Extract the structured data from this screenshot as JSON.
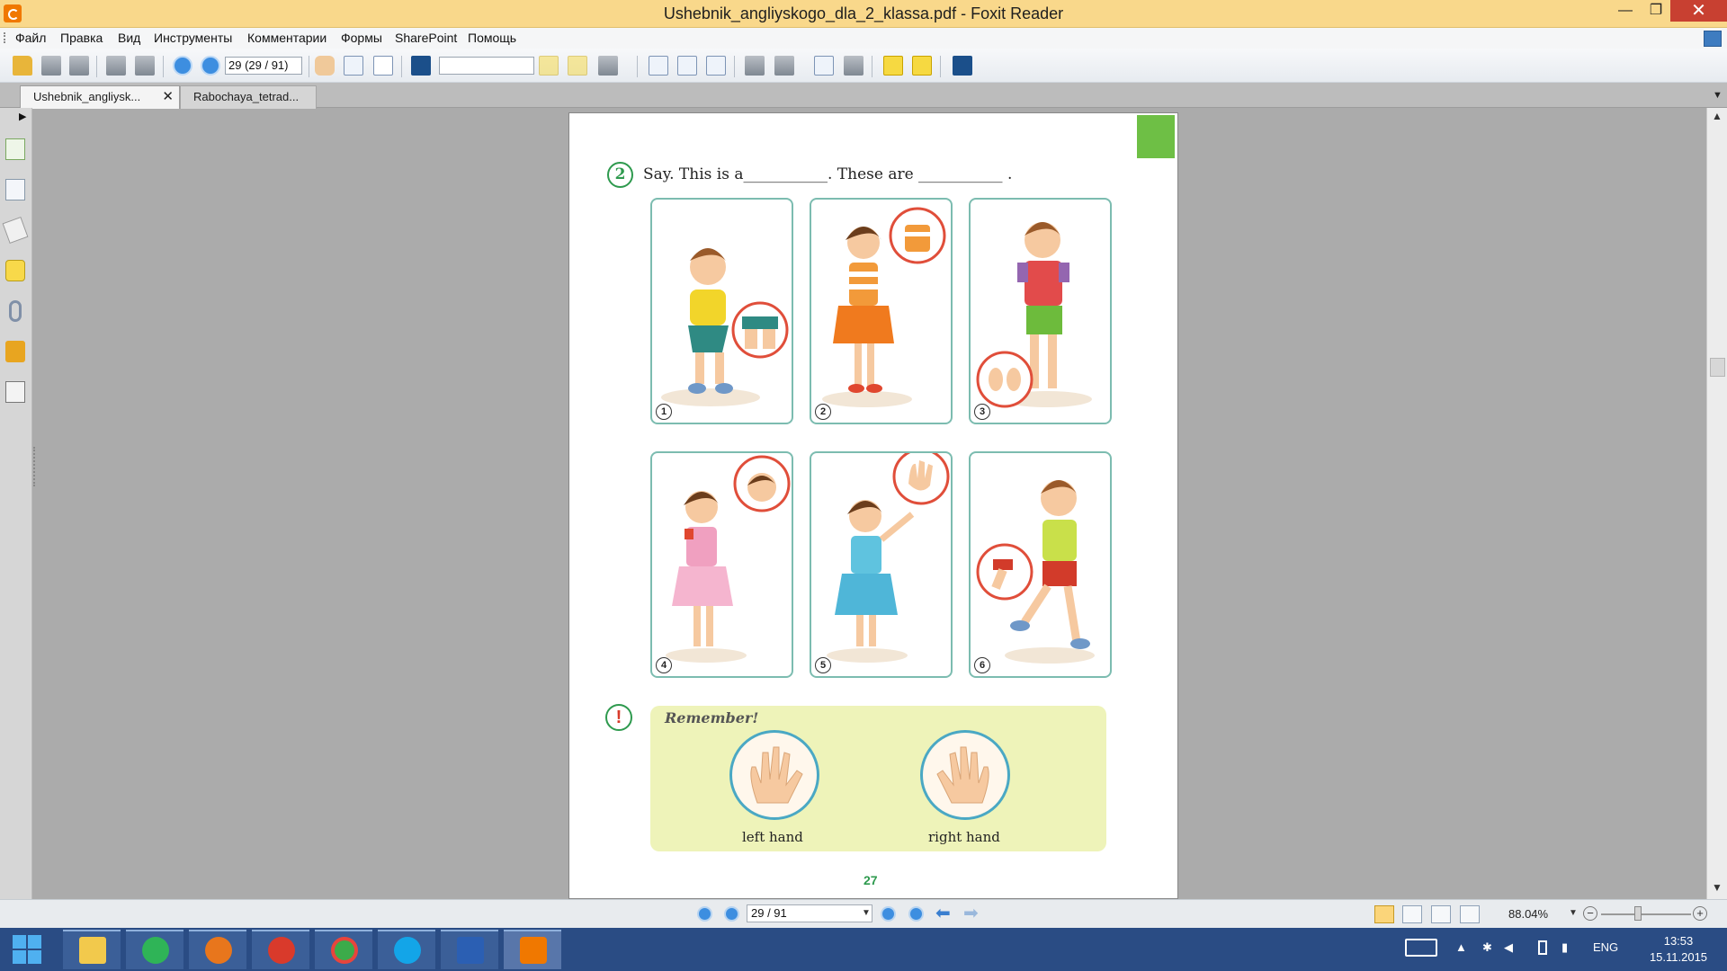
{
  "window": {
    "title": "Ushebnik_angliyskogo_dla_2_klassa.pdf - Foxit Reader",
    "min_glyph": "—",
    "max_glyph": "❐",
    "close_glyph": "✕"
  },
  "menu": {
    "items": [
      "Файл",
      "Правка",
      "Вид",
      "Инструменты",
      "Комментарии",
      "Формы",
      "SharePoint",
      "Помощь"
    ]
  },
  "toolbar": {
    "page_value": "29 (29 / 91)",
    "search_value": ""
  },
  "tabs": [
    {
      "label": "Ushebnik_angliysk...",
      "active": true,
      "close": "✕"
    },
    {
      "label": "Rabochaya_tetrad...",
      "active": false
    }
  ],
  "document": {
    "exercise_number": "2",
    "instruction": "Say. This is a___________. These are ___________ .",
    "cards": [
      {
        "num": "1",
        "subject": "boy squatting, knees callout"
      },
      {
        "num": "2",
        "subject": "girl, shoulders callout"
      },
      {
        "num": "3",
        "subject": "boy, feet callout"
      },
      {
        "num": "4",
        "subject": "girl, head callout"
      },
      {
        "num": "5",
        "subject": "girl waving, hand callout"
      },
      {
        "num": "6",
        "subject": "boy kicking, leg callout"
      }
    ],
    "remember_mark": "!",
    "remember_title": "Remember!",
    "left_hand": "left hand",
    "right_hand": "right hand",
    "page_number": "27"
  },
  "statusbar": {
    "page_value": "29 / 91",
    "zoom": "88.04%"
  },
  "tray": {
    "lang": "ENG",
    "time": "13:53",
    "date": "15.11.2015"
  },
  "colors": {
    "titlebar": "#f9d88b",
    "accent_green": "#2e9a4e",
    "taskbar": "#2a4c84"
  }
}
